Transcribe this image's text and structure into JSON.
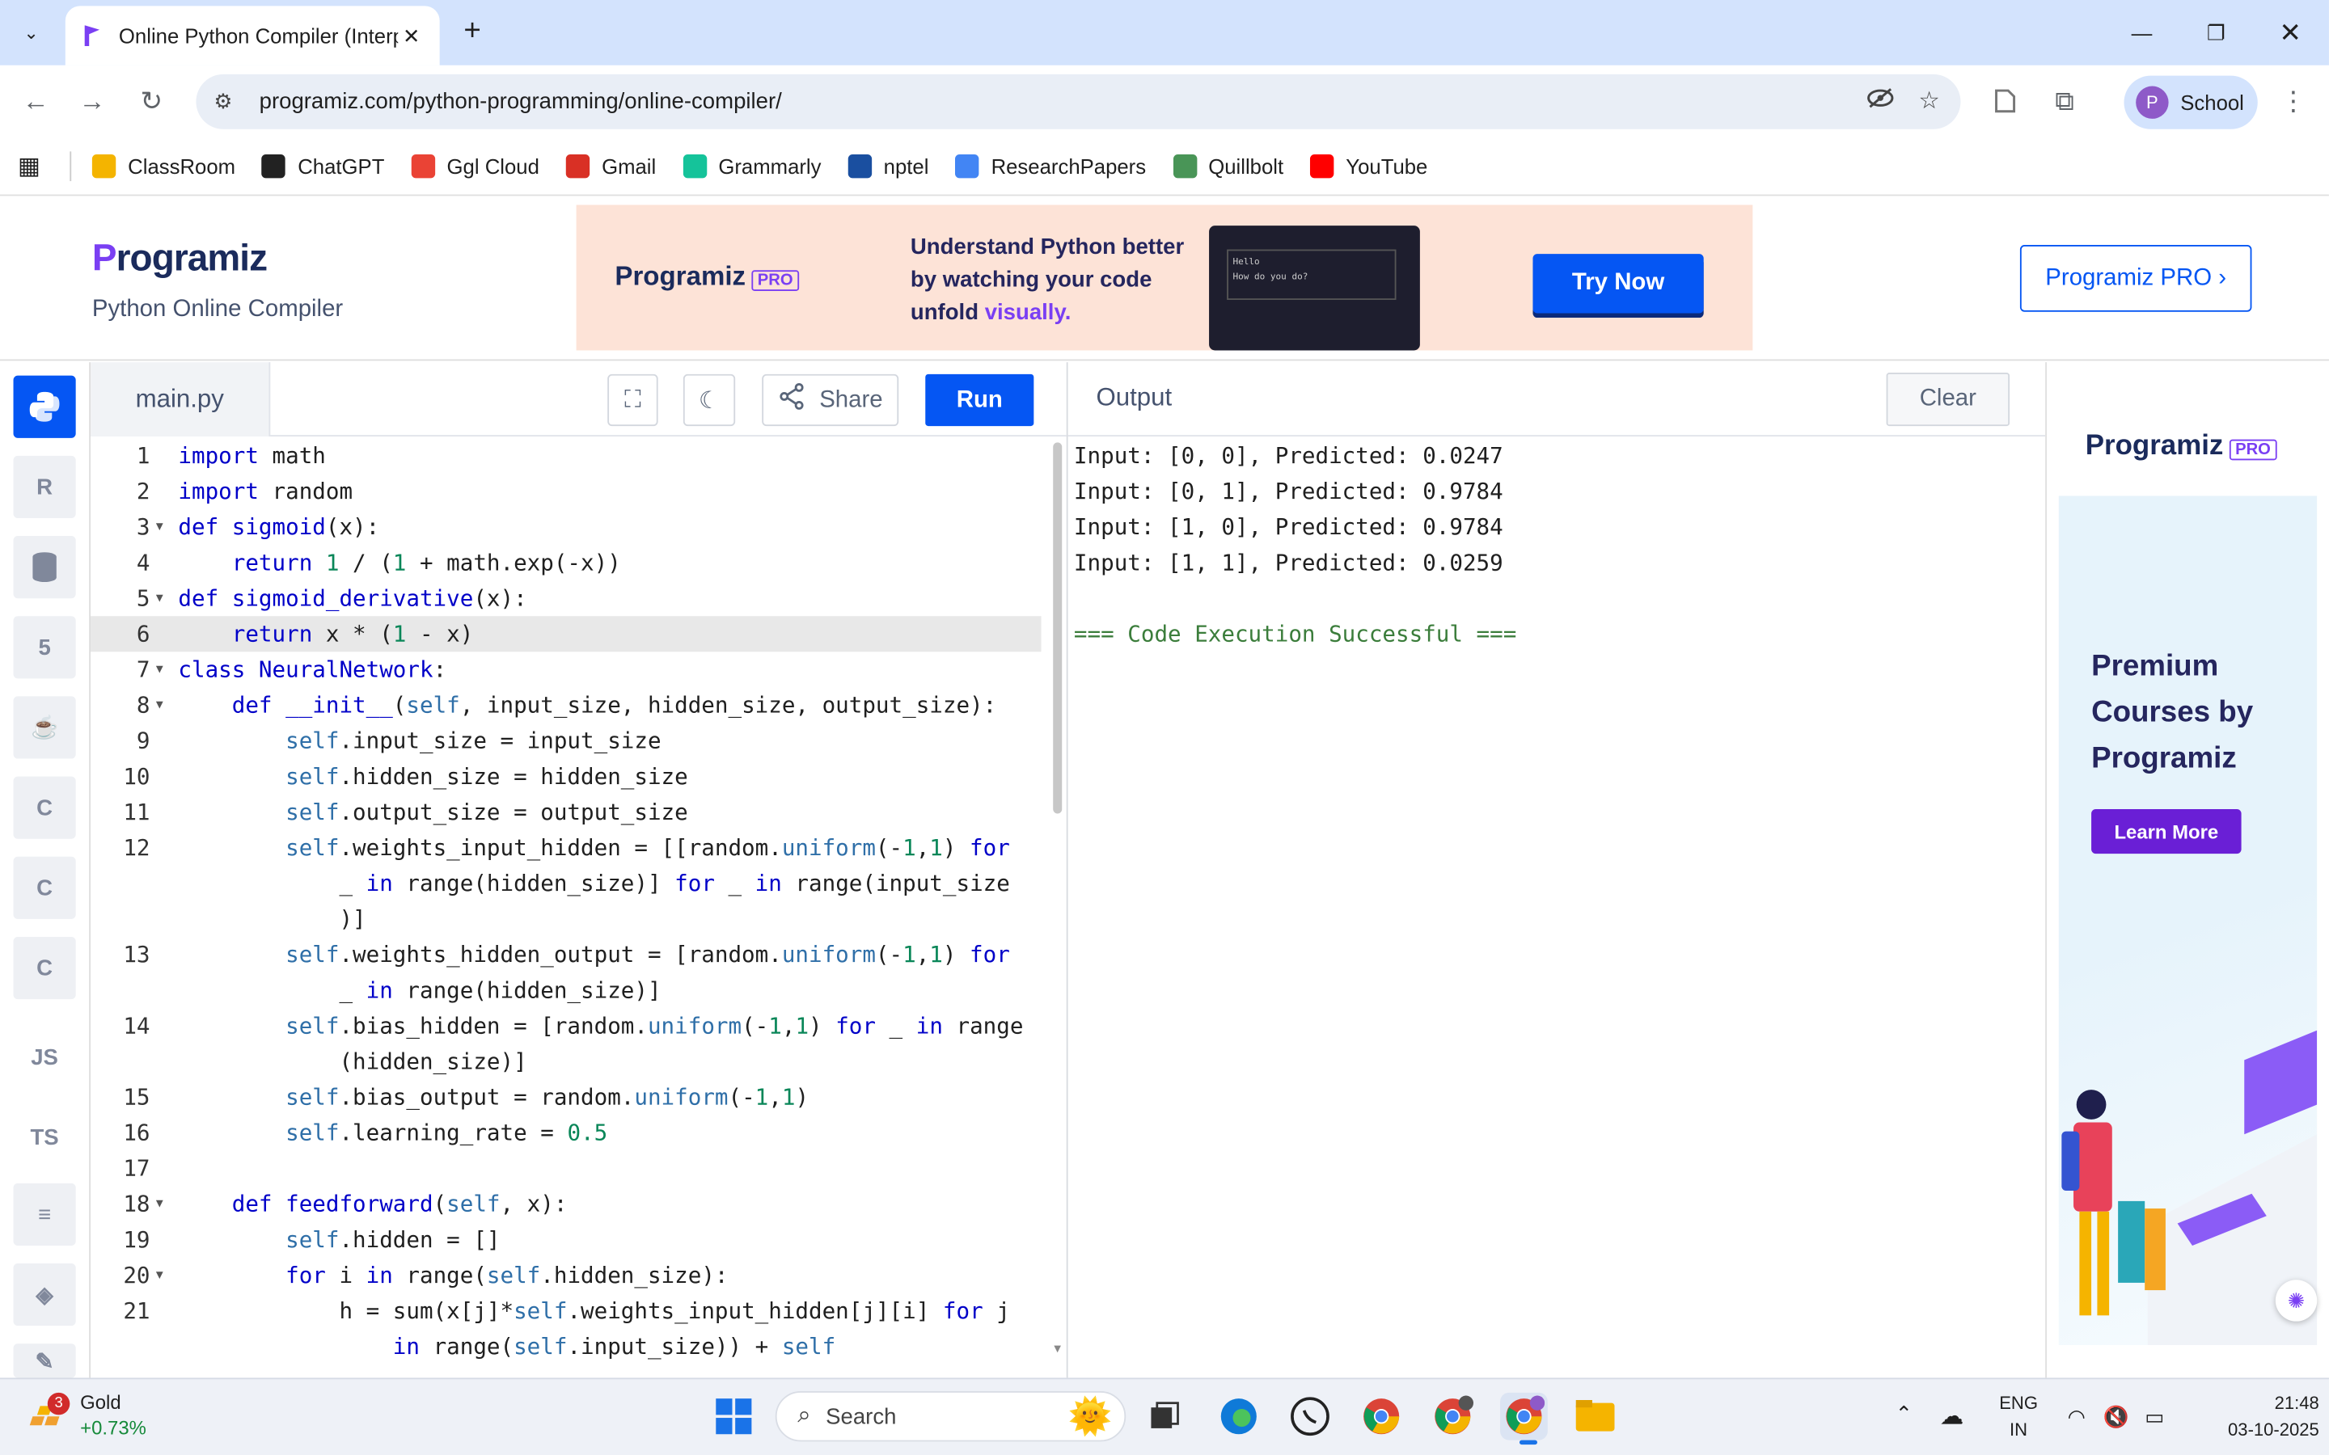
{
  "browser": {
    "tab_title": "Online Python Compiler (Interp",
    "url": "programiz.com/python-programming/online-compiler/",
    "profile_initial": "P",
    "profile_label": "School"
  },
  "bookmarks": [
    {
      "label": "ClassRoom",
      "icon": "classroom-icon",
      "color": "#f4b400"
    },
    {
      "label": "ChatGPT",
      "icon": "chatgpt-icon",
      "color": "#222222"
    },
    {
      "label": "Ggl Cloud",
      "icon": "cloud-icon",
      "color": "#ea4335"
    },
    {
      "label": "Gmail",
      "icon": "gmail-icon",
      "color": "#d93025"
    },
    {
      "label": "Grammarly",
      "icon": "grammarly-icon",
      "color": "#15c39a"
    },
    {
      "label": "nptel",
      "icon": "nptel-icon",
      "color": "#1a4fa0"
    },
    {
      "label": "ResearchPapers",
      "icon": "docs-icon",
      "color": "#4285f4"
    },
    {
      "label": "Quillbolt",
      "icon": "quillbot-icon",
      "color": "#499557"
    },
    {
      "label": "YouTube",
      "icon": "youtube-icon",
      "color": "#ff0000"
    }
  ],
  "header": {
    "logo_text": "Programiz",
    "subtitle": "Python Online Compiler",
    "pro_button": "Programiz PRO ›"
  },
  "banner": {
    "logo": "Programiz",
    "badge": "PRO",
    "text_1": "Understand Python better by watching your code unfold ",
    "text_highlight": "visually.",
    "preview_text": "Hello\nHow do you do?",
    "cta": "Try Now"
  },
  "editor": {
    "file_name": "main.py",
    "share_label": "Share",
    "run_label": "Run"
  },
  "code_lines": [
    {
      "n": "1"
    },
    {
      "n": "2"
    },
    {
      "n": "3"
    },
    {
      "n": "4"
    },
    {
      "n": "5"
    },
    {
      "n": "6"
    },
    {
      "n": "7"
    },
    {
      "n": "8"
    },
    {
      "n": "9"
    },
    {
      "n": "10"
    },
    {
      "n": "11"
    },
    {
      "n": "12"
    },
    {
      "n": "13"
    },
    {
      "n": "14"
    },
    {
      "n": "15"
    },
    {
      "n": "16"
    },
    {
      "n": "17"
    },
    {
      "n": "18"
    },
    {
      "n": "19"
    },
    {
      "n": "20"
    },
    {
      "n": "21"
    }
  ],
  "output": {
    "title": "Output",
    "clear_label": "Clear",
    "lines": [
      "Input: [0, 0], Predicted: 0.0247",
      "Input: [0, 1], Predicted: 0.9784",
      "Input: [1, 0], Predicted: 0.9784",
      "Input: [1, 1], Predicted: 0.0259"
    ],
    "success": "=== Code Execution Successful ==="
  },
  "ad": {
    "logo": "Programiz",
    "badge": "PRO",
    "headline": "Premium Courses by Programiz",
    "cta": "Learn More"
  },
  "languages": [
    "python-icon",
    "r-icon",
    "sql-icon",
    "html-icon",
    "java-icon",
    "c-icon",
    "cpp-icon",
    "csharp-icon",
    "js-icon",
    "ts-icon",
    "go-icon",
    "php-icon",
    "swift-icon"
  ],
  "lang_labels": {
    "js": "JS",
    "ts": "TS"
  },
  "taskbar": {
    "stock_name": "Gold",
    "stock_change": "+0.73%",
    "stock_badge": "3",
    "search_placeholder": "Search",
    "lang_1": "ENG",
    "lang_2": "IN",
    "time": "21:48",
    "date": "03-10-2025"
  }
}
